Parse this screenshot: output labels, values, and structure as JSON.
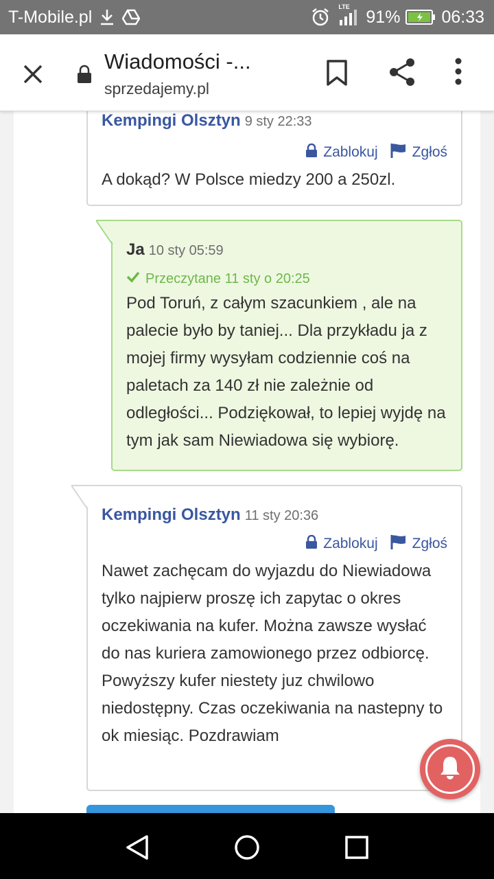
{
  "status_bar": {
    "carrier": "T-Mobile.pl",
    "network": "LTE",
    "battery": "91%",
    "time": "06:33"
  },
  "browser": {
    "title": "Wiadomości -...",
    "url": "sprzedajemy.pl"
  },
  "actions": {
    "block": "Zablokuj",
    "report": "Zgłoś"
  },
  "messages": [
    {
      "author": "Kempingi Olsztyn",
      "time": "9 sty 22:33",
      "body": "A dokąd? W Polsce miedzy 200 a 250zl."
    },
    {
      "author": "Ja",
      "time": "10 sty 05:59",
      "read": "Przeczytane 11 sty o 20:25",
      "body": "Pod Toruń, z całym szacunkiem , ale na palecie było by taniej... Dla przykładu ja z mojej firmy wysyłam codziennie coś na paletach za 140 zł nie zależnie od odległości... Podziękował, to lepiej wyjdę na tym jak sam Niewiadowa się wybiorę."
    },
    {
      "author": "Kempingi Olsztyn",
      "time": "11 sty 20:36",
      "body": "Nawet zachęcam do wyjazdu do Niewiadowa tylko najpierw proszę ich zapytac o okres oczekiwania na kufer. Można zawsze wysłać do nas kuriera zamowionego przez odbiorcę. Powyższy kufer niestety juz chwilowo niedostępny. Czas oczekiwania na nastepny to ok miesiąc. Pozdrawiam"
    }
  ],
  "colors": {
    "author": "#3a57a0",
    "mine_bg": "#eef8e1",
    "mine_border": "#a8d98a",
    "read": "#6db84a",
    "fab": "#e26262",
    "button": "#3596dc"
  }
}
